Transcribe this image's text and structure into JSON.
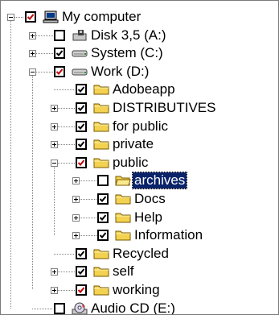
{
  "tree": {
    "root": {
      "label": "My computer",
      "checked": "partial",
      "icon": "computer-icon",
      "expanded": true
    },
    "drives": [
      {
        "label": "Disk 3,5 (A:)",
        "checked": "none",
        "icon": "floppy-drive-icon",
        "expanded": false
      },
      {
        "label": "System (C:)",
        "checked": "checked",
        "icon": "hard-drive-icon",
        "expanded": false
      },
      {
        "label": "Work (D:)",
        "checked": "partial",
        "icon": "hard-drive-icon",
        "expanded": true
      },
      {
        "label": "Audio CD (E:)",
        "checked": "none",
        "icon": "cd-drive-icon",
        "expanded": false
      }
    ],
    "work_folders": [
      {
        "label": "Adobeapp",
        "checked": "checked",
        "expandable": false
      },
      {
        "label": "DISTRIBUTIVES",
        "checked": "checked",
        "expandable": true
      },
      {
        "label": "for public",
        "checked": "checked",
        "expandable": true
      },
      {
        "label": "private",
        "checked": "checked",
        "expandable": true
      },
      {
        "label": "public",
        "checked": "partial",
        "expandable": true,
        "expanded": true
      },
      {
        "label": "Recycled",
        "checked": "checked",
        "expandable": false
      },
      {
        "label": "self",
        "checked": "checked",
        "expandable": true
      },
      {
        "label": "working",
        "checked": "partial",
        "expandable": true
      }
    ],
    "public_folders": [
      {
        "label": "archives",
        "checked": "none",
        "expandable": true,
        "selected": true,
        "open": true
      },
      {
        "label": "Docs",
        "checked": "checked",
        "expandable": true
      },
      {
        "label": "Help",
        "checked": "checked",
        "expandable": true
      },
      {
        "label": "Information",
        "checked": "checked",
        "expandable": true
      }
    ]
  },
  "colors": {
    "selection": "#0a246a",
    "partial_check": "#c00000",
    "folder": "#f2d250"
  }
}
